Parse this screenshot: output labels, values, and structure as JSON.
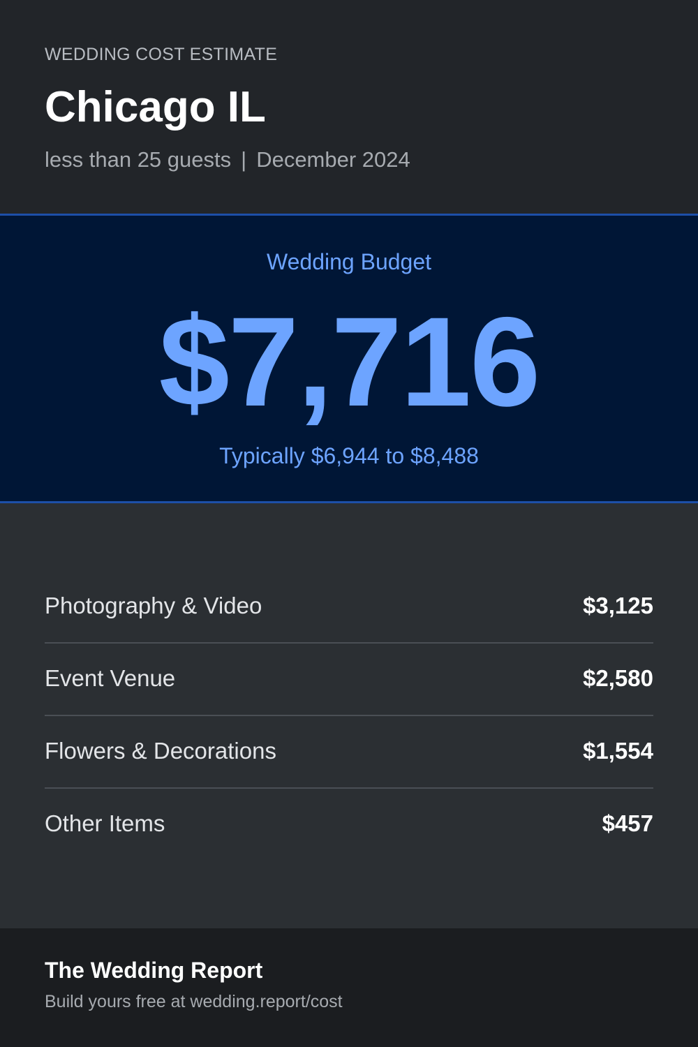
{
  "header": {
    "eyebrow": "WEDDING COST ESTIMATE",
    "city": "Chicago IL",
    "guests": "less than 25 guests",
    "separator": "|",
    "date": "December 2024"
  },
  "budget": {
    "label": "Wedding Budget",
    "amount": "$7,716",
    "range": "Typically $6,944 to $8,488"
  },
  "items": [
    {
      "label": "Photography & Video",
      "value": "$3,125"
    },
    {
      "label": "Event Venue",
      "value": "$2,580"
    },
    {
      "label": "Flowers & Decorations",
      "value": "$1,554"
    },
    {
      "label": "Other Items",
      "value": "$457"
    }
  ],
  "footer": {
    "brand": "The Wedding Report",
    "cta": "Build yours free at wedding.report/cost"
  },
  "colors": {
    "accent": "#6da4ff",
    "budget_bg": "#001636",
    "border_blue": "#1d4fa8"
  }
}
